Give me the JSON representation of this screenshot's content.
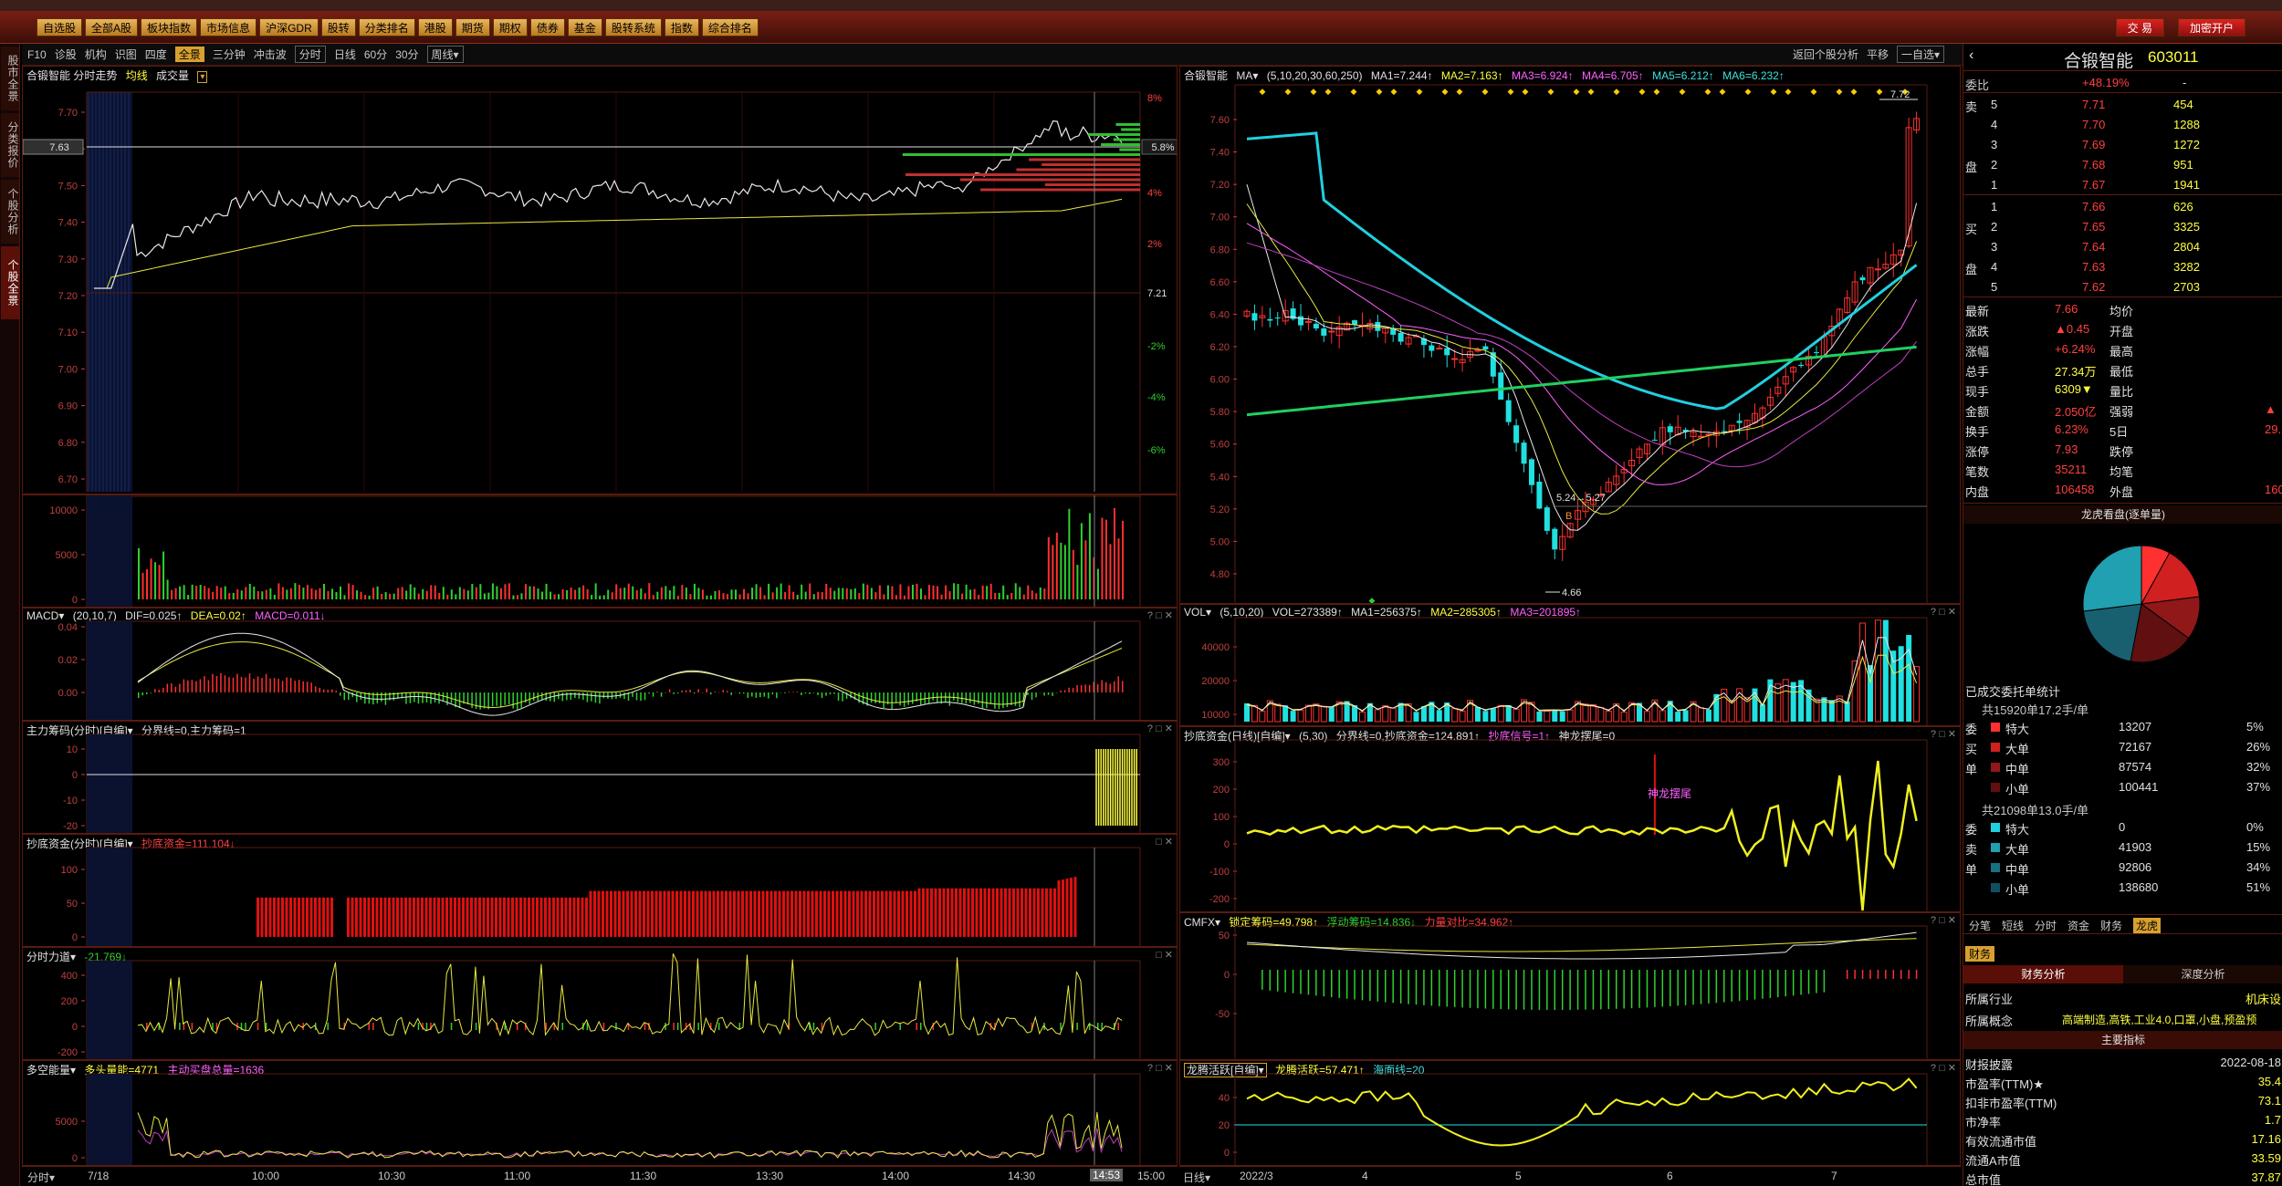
{
  "toolbar": {
    "buttons": [
      "自选股",
      "全部A股",
      "板块指数",
      "市场信息",
      "沪深GDR",
      "股转",
      "分类排名",
      "港股",
      "期货",
      "期权",
      "债券",
      "基金",
      "股转系统",
      "指数",
      "综合排名"
    ],
    "trade": "交 易",
    "open_account": "加密开户"
  },
  "sidebar": {
    "tabs": [
      "股市全景",
      "分类报价",
      "个股分析",
      "个股全景"
    ]
  },
  "subbar": {
    "left": [
      "F10",
      "诊股",
      "机构",
      "识图",
      "四度",
      "全景",
      "三分钟",
      "冲击波",
      "分时",
      "日线",
      "60分",
      "30分",
      "周线▾"
    ],
    "active": "全景",
    "right": [
      "返回个股分析",
      "平移",
      "一自选▾"
    ]
  },
  "intraday": {
    "title": "合锻智能  分时走势",
    "legend_avg": "均线",
    "legend_vol": "成交量",
    "price_labels": [
      "7.70",
      "7.60",
      "7.50",
      "7.40",
      "7.30",
      "7.20",
      "7.10",
      "7.00",
      "6.90",
      "6.80",
      "6.70"
    ],
    "current_tag": "7.63",
    "pct_labels": [
      "8%",
      "6%",
      "4%",
      "2%",
      "7.21",
      "-2%",
      "-4%",
      "-6%"
    ],
    "pct_tag": "5.8%",
    "vol_labels": [
      "10000",
      "5000",
      "0"
    ],
    "time_labels": [
      "分时▾",
      "7/18",
      "10:00",
      "10:30",
      "11:00",
      "11:30",
      "13:30",
      "14:00",
      "14:30",
      "14:53",
      "15:00"
    ]
  },
  "macd_intraday": {
    "name": "MACD▾",
    "params": "(20,10,7)",
    "dif": "DIF=0.025↑",
    "dea": "DEA=0.02↑",
    "macd": "MACD=0.011↓",
    "labels": [
      "0.04",
      "0.02",
      "0.00"
    ]
  },
  "main_chip": {
    "name": "主力筹码(分时)[自编]▾",
    "line": "分界线=0,主力筹码=1",
    "labels": [
      "10",
      "0",
      "-10",
      "-20"
    ]
  },
  "bottom_fund_i": {
    "name": "抄底资金(分时)[自编]▾",
    "line": "抄底资金=111.104↓",
    "labels": [
      "100",
      "50",
      "0"
    ]
  },
  "force": {
    "name": "分时力道▾",
    "line": "-21.769↓",
    "labels": [
      "400",
      "200",
      "0",
      "-200"
    ]
  },
  "longshort": {
    "name": "多空能量▾",
    "l1": "多头量能=4771",
    "l2": "主动买盘总量=1636",
    "labels": [
      "5000",
      "0"
    ]
  },
  "daily": {
    "title": "合锻智能",
    "ma": "MA▾",
    "params": "(5,10,20,30,60,250)",
    "ma1": "MA1=7.244↑",
    "ma2": "MA2=7.163↑",
    "ma3": "MA3=6.924↑",
    "ma4": "MA4=6.705↑",
    "ma5": "MA5=6.212↑",
    "ma6": "MA6=6.232↑",
    "price_labels": [
      "7.60",
      "7.40",
      "7.20",
      "7.00",
      "6.80",
      "6.60",
      "6.40",
      "6.20",
      "6.00",
      "5.80",
      "5.60",
      "5.40",
      "5.20",
      "5.00",
      "4.80"
    ],
    "hi": "7.72",
    "lo": "4.66",
    "mid": "5.24→5.27",
    "date_labels": [
      "日线▾",
      "2022/3",
      "4",
      "5",
      "6",
      "7"
    ]
  },
  "vol_daily": {
    "name": "VOL▾",
    "params": "(5,10,20)",
    "v": "VOL=273389↑",
    "m1": "MA1=256375↑",
    "m2": "MA2=285305↑",
    "m3": "MA3=201895↑",
    "labels": [
      "40000",
      "20000",
      "10000"
    ]
  },
  "bottom_fund_d": {
    "name": "抄底资金(日线)[自编]▾",
    "params": "(5,30)",
    "line1": "分界线=0,抄底资金=124.891↑",
    "line2": "抄底信号=1↑",
    "line3": "神龙摆尾=0",
    "tag": "神龙摆尾",
    "labels": [
      "300",
      "200",
      "100",
      "0",
      "-100",
      "-200"
    ]
  },
  "cmfx": {
    "name": "CMFX▾",
    "l1": "锁定筹码=49.798↑",
    "l2": "浮动筹码=14.836↓",
    "l3": "力量对比=34.962↑",
    "labels": [
      "50",
      "0",
      "-50"
    ]
  },
  "dragon": {
    "name": "龙腾活跃[自编]▾",
    "l1": "龙腾活跃=57.471↑",
    "l2": "海面线=20",
    "labels": [
      "40",
      "20",
      "0"
    ]
  },
  "quote": {
    "name": "合锻智能",
    "code": "603011",
    "weibi_label": "委比",
    "weibi": "+48.19%",
    "weicha": "-",
    "sell": [
      [
        "卖",
        "5",
        "7.71",
        "454"
      ],
      [
        "",
        "4",
        "7.70",
        "1288"
      ],
      [
        "",
        "3",
        "7.69",
        "1272"
      ],
      [
        "盘",
        "2",
        "7.68",
        "951"
      ],
      [
        "",
        "1",
        "7.67",
        "1941"
      ]
    ],
    "buy": [
      [
        "",
        "1",
        "7.66",
        "626"
      ],
      [
        "买",
        "2",
        "7.65",
        "3325"
      ],
      [
        "",
        "3",
        "7.64",
        "2804"
      ],
      [
        "盘",
        "4",
        "7.63",
        "3282"
      ],
      [
        "",
        "5",
        "7.62",
        "2703"
      ]
    ],
    "stats": [
      [
        "最新",
        "7.66",
        "均价",
        ""
      ],
      [
        "涨跌",
        "▲0.45",
        "开盘",
        ""
      ],
      [
        "涨幅",
        "+6.24%",
        "最高",
        ""
      ],
      [
        "总手",
        "27.34万",
        "最低",
        ""
      ],
      [
        "现手",
        "6309▼",
        "量比",
        ""
      ],
      [
        "金额",
        "2.050亿",
        "强弱",
        "▲"
      ],
      [
        "换手",
        "6.23%",
        "5日",
        "29."
      ],
      [
        "涨停",
        "7.93",
        "跌停",
        ""
      ],
      [
        "笔数",
        "35211",
        "均笔",
        ""
      ],
      [
        "内盘",
        "106458",
        "外盘",
        "160"
      ]
    ]
  },
  "dragon_pie": {
    "title": "龙虎看盘(逐单量)",
    "slices": [
      8,
      15,
      12,
      18,
      20,
      27
    ]
  },
  "orders": {
    "title": "已成交委托单统计",
    "buy_hdr": "共15920单17.2手/单",
    "buy": [
      [
        "委",
        "特大",
        "13207",
        "5%"
      ],
      [
        "买",
        "大单",
        "72167",
        "26%"
      ],
      [
        "单",
        "中单",
        "87574",
        "32%"
      ],
      [
        "",
        "小单",
        "100441",
        "37%"
      ]
    ],
    "sell_hdr": "共21098单13.0手/单",
    "sell": [
      [
        "委",
        "特大",
        "0",
        "0%"
      ],
      [
        "卖",
        "大单",
        "41903",
        "15%"
      ],
      [
        "单",
        "中单",
        "92806",
        "34%"
      ],
      [
        "",
        "小单",
        "138680",
        "51%"
      ]
    ]
  },
  "rtabs": [
    "分笔",
    "短线",
    "分时",
    "资金",
    "财务",
    "龙虎"
  ],
  "rtab_active": "龙虎",
  "finance": {
    "tab": "财务",
    "left": "财务分析",
    "right": "深度分析",
    "industry_label": "所属行业",
    "industry": "机床设",
    "concept_label": "所属概念",
    "concept": "高端制造,高铁,工业4.0,口罩,小盘,预盈预",
    "main_index": "主要指标",
    "rows": [
      [
        "财报披露",
        "2022-08-18"
      ],
      [
        "市盈率(TTM)★",
        "35.4"
      ],
      [
        "扣非市盈率(TTM)",
        "73.1"
      ],
      [
        "市净率",
        "1.7"
      ],
      [
        "有效流通市值",
        "17.16"
      ],
      [
        "流通A市值",
        "33.59"
      ],
      [
        "总市值",
        "37.87"
      ]
    ]
  },
  "colors": {
    "up": "#ff3030",
    "down": "#20e0e0",
    "grid": "#5a1a10",
    "ma250": "#20d060",
    "ma60": "#20d0e0"
  }
}
